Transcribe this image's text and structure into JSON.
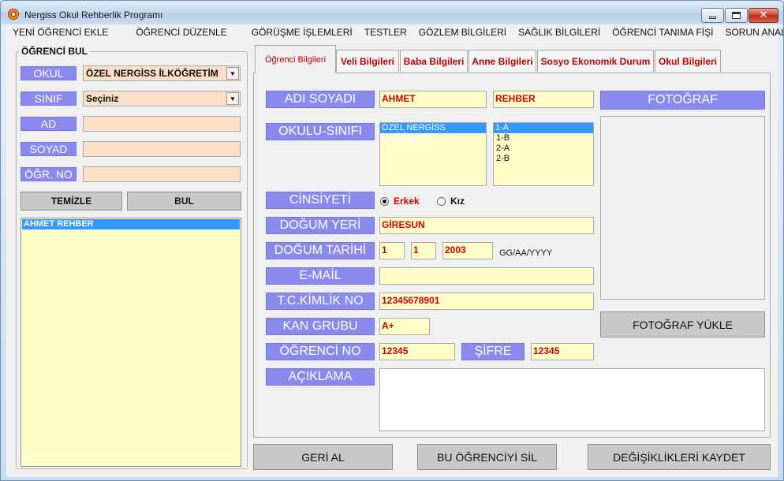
{
  "window": {
    "title": "Nergiss Okul Rehberlik Programı"
  },
  "menu": [
    "YENİ ÖĞRENCİ EKLE",
    "ÖĞRENCİ DÜZENLE",
    "GÖRÜŞME İŞLEMLERİ",
    "TESTLER",
    "GÖZLEM BİLGİLERİ",
    "SAĞLIK BİLGİLERİ",
    "ÖĞRENCİ TANIMA FİŞİ",
    "SORUN ANALİZİ"
  ],
  "search": {
    "group_title": "ÖĞRENCİ BUL",
    "okul_label": "OKUL",
    "okul_value": "ÖZEL NERGİSS İLKÖĞRETİM",
    "sinif_label": "SINIF",
    "sinif_value": "Seçiniz",
    "ad_label": "AD",
    "ad_value": "",
    "soyad_label": "SOYAD",
    "soyad_value": "",
    "no_label": "ÖĞR. NO",
    "no_value": "",
    "clear_label": "TEMİZLE",
    "find_label": "BUL",
    "results": [
      "AHMET REHBER"
    ]
  },
  "tabs": [
    "Öğrenci Bilgileri",
    "Veli Bilgileri",
    "Baba Bilgileri",
    "Anne Bilgileri",
    "Sosyo Ekonomik Durum",
    "Okul Bilgileri"
  ],
  "student": {
    "name_label": "ADI SOYADI",
    "first_name": "AHMET",
    "last_name": "REHBER",
    "school_label": "OKULU-SINIFI",
    "schools": [
      "ÖZEL NERGİSS İLKÖĞRETİ"
    ],
    "classes": [
      "1-A",
      "1-B",
      "2-A",
      "2-B"
    ],
    "gender_label": "CİNSİYETİ",
    "gender_male": "Erkek",
    "gender_female": "Kız",
    "birthplace_label": "DOĞUM YERİ",
    "birthplace": "GİRESUN",
    "birthdate_label": "DOĞUM TARİHİ",
    "birth_day": "1",
    "birth_month": "1",
    "birth_year": "2003",
    "date_format": "GG/AA/YYYY",
    "email_label": "E-MAİL",
    "email": "",
    "tc_label": "T.C.KİMLİK NO",
    "tc": "12345678901",
    "blood_label": "KAN GRUBU",
    "blood": "A+",
    "student_no_label": "ÖĞRENCİ NO",
    "student_no": "12345",
    "password_label": "ŞİFRE",
    "password": "12345",
    "notes_label": "AÇIKLAMA",
    "notes": "",
    "photo_label": "FOTOĞRAF",
    "photo_upload_label": "FOTOĞRAF YÜKLE"
  },
  "actions": {
    "undo_label": "GERİ AL",
    "delete_label": "BU ÖĞRENCİYİ SİL",
    "save_label": "DEĞİŞİKLİKLERİ KAYDET"
  },
  "colors": {
    "label_bg": "#8a8aee",
    "field_yellow": "#fffdc8",
    "field_peach": "#fbe0c8",
    "value_red": "#d40000",
    "selection_blue": "#3399ff"
  }
}
